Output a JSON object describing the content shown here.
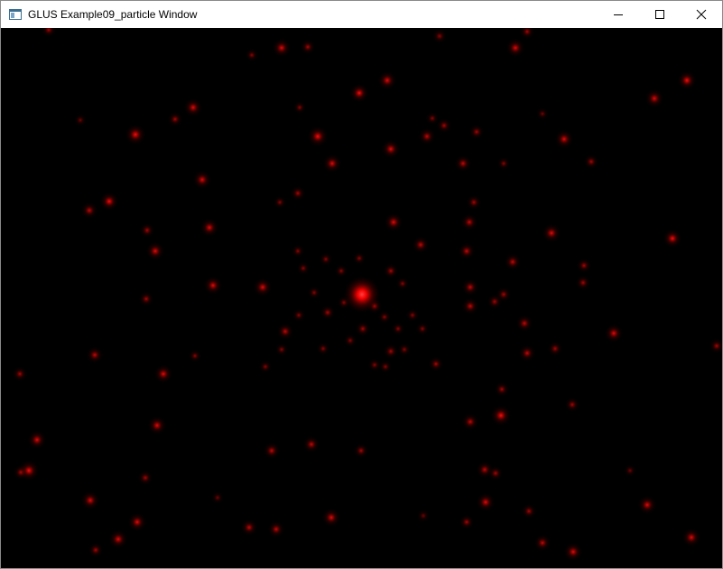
{
  "window": {
    "title": "GLUS Example09_particle Window",
    "icon": "application-window-icon",
    "controls": {
      "minimize": "minimize-icon",
      "maximize": "maximize-icon",
      "close": "close-icon"
    }
  },
  "viewport": {
    "background_color": "#000000",
    "particle_color": "#ff0000"
  }
}
